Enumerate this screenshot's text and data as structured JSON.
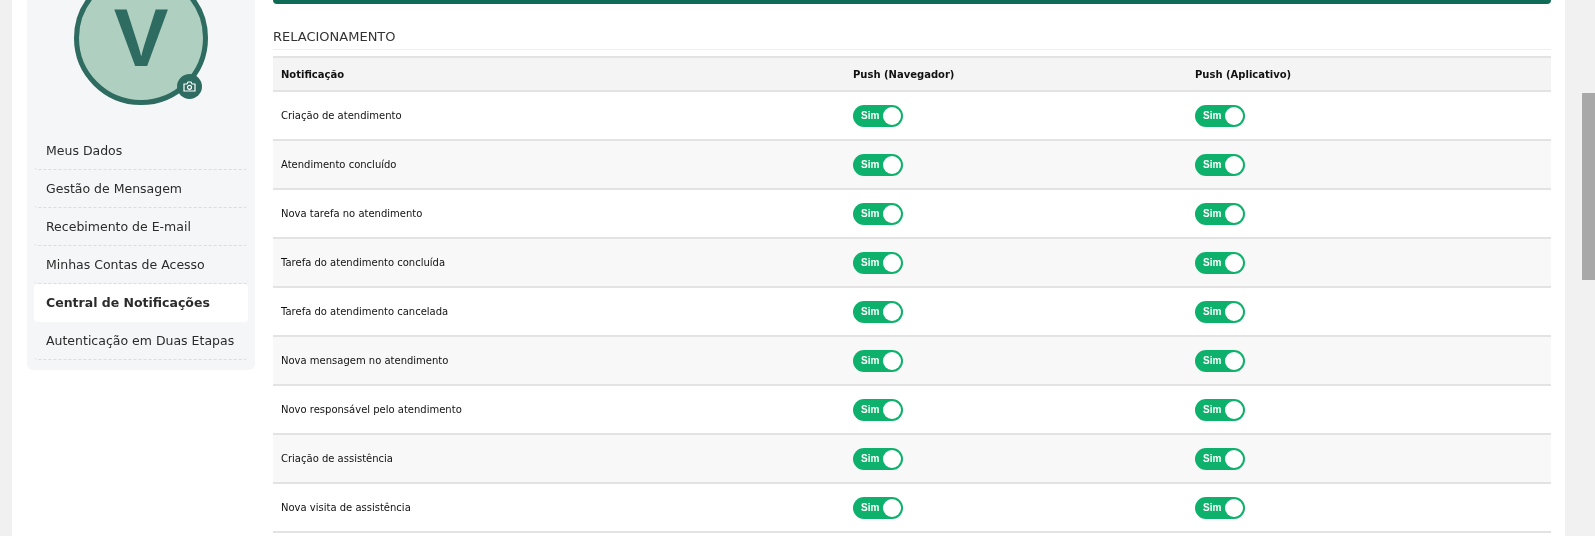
{
  "profile": {
    "avatar_letter": "V"
  },
  "sidebar": {
    "items": [
      {
        "label": "Meus Dados",
        "selected": false
      },
      {
        "label": "Gestão de Mensagem",
        "selected": false
      },
      {
        "label": "Recebimento de E-mail",
        "selected": false
      },
      {
        "label": "Minhas Contas de Acesso",
        "selected": false
      },
      {
        "label": "Central de Notificações",
        "selected": true
      },
      {
        "label": "Autenticação em Duas Etapas",
        "selected": false
      }
    ]
  },
  "section": {
    "title": "RELACIONAMENTO"
  },
  "table": {
    "columns": [
      "Notificação",
      "Push (Navegador)",
      "Push (Aplicativo)"
    ],
    "rows": [
      {
        "name": "Criação de atendimento",
        "browser": {
          "label": "Sim",
          "on": true
        },
        "app": {
          "label": "Sim",
          "on": true
        }
      },
      {
        "name": "Atendimento concluído",
        "browser": {
          "label": "Sim",
          "on": true
        },
        "app": {
          "label": "Sim",
          "on": true
        }
      },
      {
        "name": "Nova tarefa no atendimento",
        "browser": {
          "label": "Sim",
          "on": true
        },
        "app": {
          "label": "Sim",
          "on": true
        }
      },
      {
        "name": "Tarefa do atendimento concluída",
        "browser": {
          "label": "Sim",
          "on": true
        },
        "app": {
          "label": "Sim",
          "on": true
        }
      },
      {
        "name": "Tarefa do atendimento cancelada",
        "browser": {
          "label": "Sim",
          "on": true
        },
        "app": {
          "label": "Sim",
          "on": true
        }
      },
      {
        "name": "Nova mensagem no atendimento",
        "browser": {
          "label": "Sim",
          "on": true
        },
        "app": {
          "label": "Sim",
          "on": true
        }
      },
      {
        "name": "Novo responsável pelo atendimento",
        "browser": {
          "label": "Sim",
          "on": true
        },
        "app": {
          "label": "Sim",
          "on": true
        }
      },
      {
        "name": "Criação de assistência",
        "browser": {
          "label": "Sim",
          "on": true
        },
        "app": {
          "label": "Sim",
          "on": true
        }
      },
      {
        "name": "Nova visita de assistência",
        "browser": {
          "label": "Sim",
          "on": true
        },
        "app": {
          "label": "Sim",
          "on": true
        }
      }
    ]
  }
}
